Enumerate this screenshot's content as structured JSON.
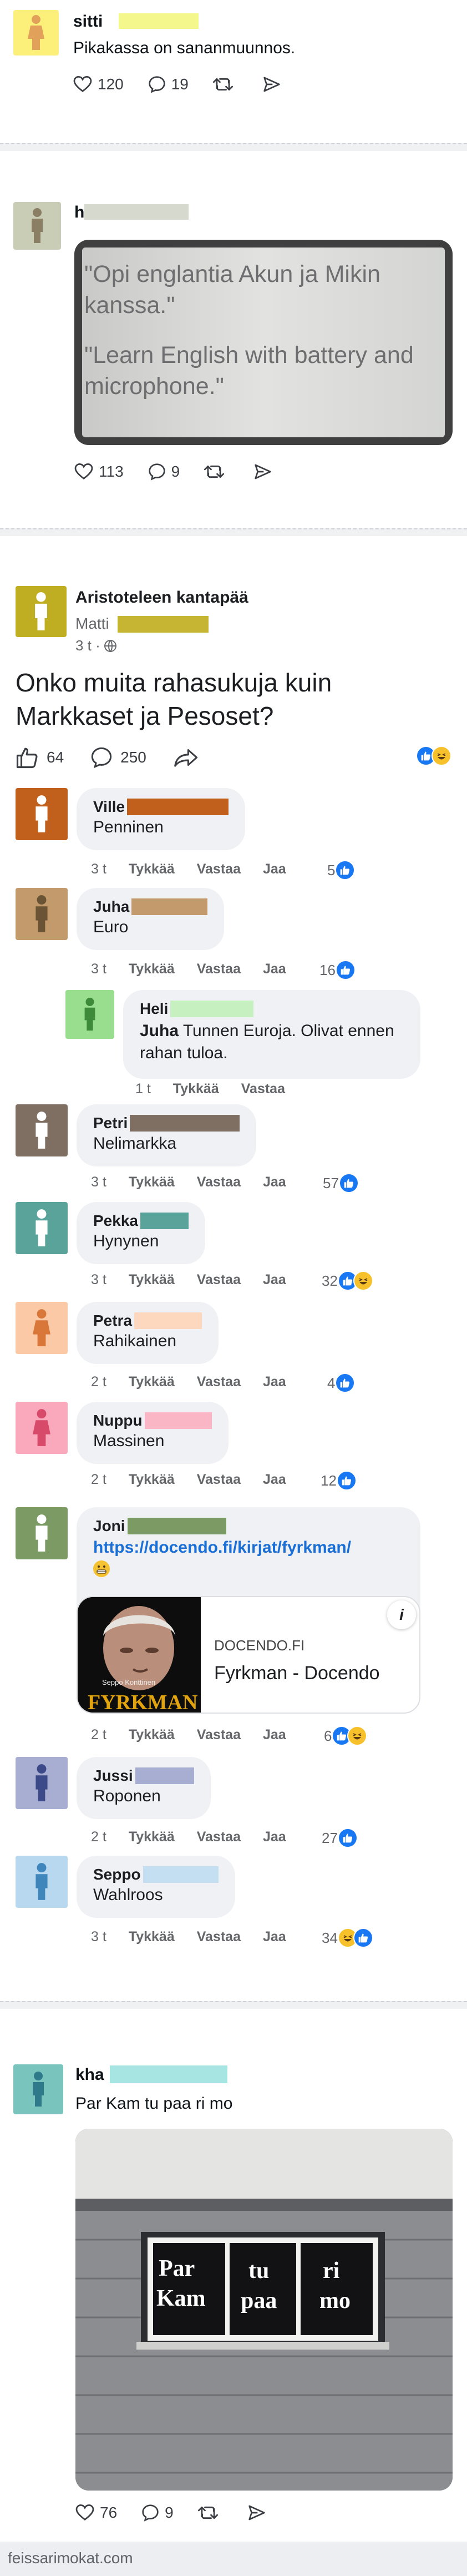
{
  "post1": {
    "name": "sitti",
    "text": "Pikakassa on sananmuunnos.",
    "likes": "120",
    "replies": "19",
    "avatar_color": "#fdf07a",
    "redact_color": "#f4f78b"
  },
  "post2": {
    "name": "h",
    "quote1": "\"Opi englantia Akun ja Mikin kanssa.\"",
    "quote2": "\"Learn English with battery and microphone.\"",
    "likes": "113",
    "replies": "9",
    "avatar_color": "#c9cdb5",
    "redact_color": "#d6d9cd"
  },
  "fbpost": {
    "group": "Aristoteleen kantapää",
    "author": "Matti",
    "time": "3 t · ",
    "title": "Onko muita rahasukuja kuin Markkaset ja Pesoset?",
    "likes": "64",
    "comments": "250",
    "avatar_color": "#bfae22"
  },
  "comment_labels": {
    "like": "Tykkää",
    "reply": "Vastaa",
    "share": "Jaa"
  },
  "comments": [
    {
      "name": "Ville",
      "text": "Penninen",
      "time": "3 t",
      "count": "5",
      "color": "#c0601c"
    },
    {
      "name": "Juha",
      "text": "Euro",
      "time": "3 t",
      "count": "16",
      "color": "#c29a6b"
    },
    {
      "name": "Heli",
      "mention": "Juha",
      "text": " Tunnen Euroja. Olivat ennen rahan tuloa.",
      "time": "1 t",
      "color": "#98de8e"
    },
    {
      "name": "Petri",
      "text": "Nelimarkka",
      "time": "3 t",
      "count": "57",
      "color": "#7f6f63"
    },
    {
      "name": "Pekka",
      "text": "Hynynen",
      "time": "3 t",
      "count": "32",
      "color": "#5aa39b"
    },
    {
      "name": "Petra",
      "text": "Rahikainen",
      "time": "2 t",
      "count": "4",
      "color": "#fbc9a6"
    },
    {
      "name": "Nuppu",
      "text": "Massinen",
      "time": "2 t",
      "count": "12",
      "color": "#f9a9bb"
    },
    {
      "name": "Joni",
      "link": "https://docendo.fi/kirjat/fyrkman/",
      "time": "2 t",
      "count": "6",
      "color": "#7c9a63"
    },
    {
      "name": "Jussi",
      "text": "Roponen",
      "time": "2 t",
      "count": "27",
      "color": "#a7aed2"
    },
    {
      "name": "Seppo",
      "text": "Wahlroos",
      "time": "3 t",
      "count": "34",
      "color": "#b8d8f0"
    }
  ],
  "link_preview": {
    "domain": "DOCENDO.FI",
    "title": "Fyrkman - Docendo",
    "book_author": "Seppo Konttinen",
    "book_title": "FYRKMAN",
    "info": "i"
  },
  "post3": {
    "name": "kha",
    "text": "Par Kam tu paa ri mo",
    "window_text": [
      "Par",
      "Kam",
      "tu",
      "paa",
      "ri",
      "mo"
    ],
    "likes": "76",
    "replies": "9",
    "avatar_color": "#79c4bd",
    "redact_color": "#a6e5e1"
  },
  "footer": "feissarimokat.com"
}
